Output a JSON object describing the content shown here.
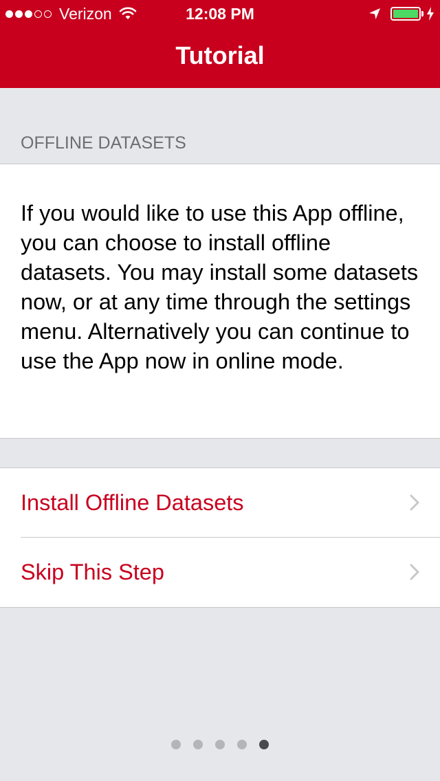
{
  "status_bar": {
    "carrier": "Verizon",
    "time": "12:08 PM",
    "signal_filled": 3,
    "signal_total": 5,
    "battery_color": "#4cd964",
    "battery_level": 1.0
  },
  "nav": {
    "title": "Tutorial"
  },
  "section": {
    "header": "OFFLINE DATASETS",
    "description": "If you would like to use this App offline, you can choose to install offline datasets. You may install some datasets now, or at any time through the settings menu. Alternatively you can continue to use the App now in online mode."
  },
  "actions": [
    {
      "label": "Install Offline Datasets",
      "icon": "chevron-right-icon"
    },
    {
      "label": "Skip This Step",
      "icon": "chevron-right-icon"
    }
  ],
  "page_indicator": {
    "total": 5,
    "current": 5
  },
  "colors": {
    "brand": "#c8001e",
    "background": "#e6e7eb",
    "section_text": "#6d6d72",
    "separator": "#c8c7cc"
  }
}
